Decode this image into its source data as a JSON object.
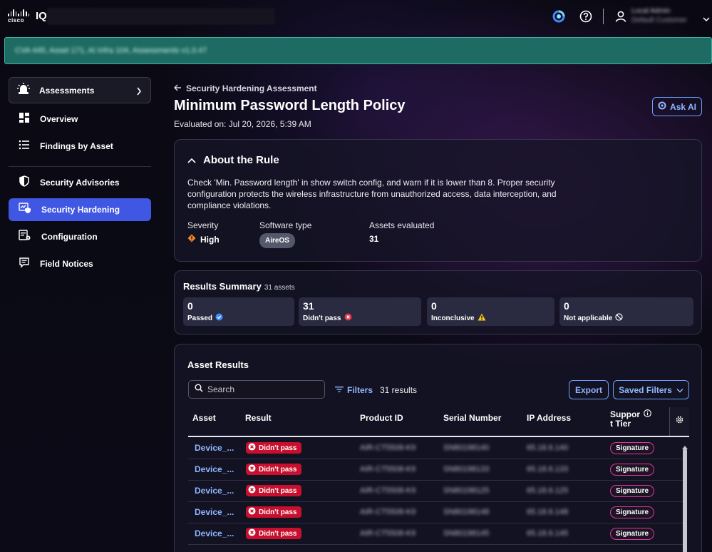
{
  "topbar": {
    "brand": "cisco",
    "product": "IQ",
    "user_name": "Local Admin",
    "user_org": "Default Customer"
  },
  "banner": {
    "text": "CVA 445, Asset 171, AI Infra 104, Assessments v1.0.47"
  },
  "sidebar": {
    "header": "Assessments",
    "items": [
      {
        "label": "Overview"
      },
      {
        "label": "Findings by Asset"
      },
      {
        "label": "Security Advisories"
      },
      {
        "label": "Security Hardening"
      },
      {
        "label": "Configuration"
      },
      {
        "label": "Field Notices"
      }
    ]
  },
  "page": {
    "back_label": "Security Hardening Assessment",
    "title": "Minimum Password Length Policy",
    "evaluated": "Evaluated on: Jul 20, 2026, 5:39 AM",
    "ask_ai": "Ask AI"
  },
  "about": {
    "heading": "About the Rule",
    "description": "Check 'Min. Password length' in show switch config, and warn if it is lower than 8. Proper security configuration protects the wireless infrastructure from unauthorized access, data interception, and compliance violations.",
    "severity_label": "Severity",
    "severity_value": "High",
    "software_label": "Software type",
    "software_value": "AireOS",
    "assets_label": "Assets evaluated",
    "assets_value": "31"
  },
  "summary": {
    "title": "Results Summary",
    "subtitle": "31 assets",
    "stats": [
      {
        "num": "0",
        "label": "Passed"
      },
      {
        "num": "31",
        "label": "Didn't pass"
      },
      {
        "num": "0",
        "label": "Inconclusive"
      },
      {
        "num": "0",
        "label": "Not applicable"
      }
    ]
  },
  "assets": {
    "title": "Asset Results",
    "search_placeholder": "Search",
    "filters_label": "Filters",
    "results_count": "31 results",
    "export_label": "Export",
    "saved_filters_label": "Saved Filters",
    "columns": [
      "Asset",
      "Result",
      "Product ID",
      "Serial Number",
      "IP Address",
      "Suppor",
      "t Tier"
    ],
    "rows": [
      {
        "asset": "Device_...",
        "result": "Didn't pass",
        "product": "AIR-CT5508-K9",
        "serial": "SN80198140",
        "ip": "65.18.6.140",
        "tier": "Signature"
      },
      {
        "asset": "Device_...",
        "result": "Didn't pass",
        "product": "AIR-CT5508-K9",
        "serial": "SN80198133",
        "ip": "65.18.6.133",
        "tier": "Signature"
      },
      {
        "asset": "Device_...",
        "result": "Didn't pass",
        "product": "AIR-CT5508-K9",
        "serial": "SN80198125",
        "ip": "65.18.6.125",
        "tier": "Signature"
      },
      {
        "asset": "Device_...",
        "result": "Didn't pass",
        "product": "AIR-CT5508-K9",
        "serial": "SN80198148",
        "ip": "65.18.6.148",
        "tier": "Signature"
      },
      {
        "asset": "Device_...",
        "result": "Didn't pass",
        "product": "AIR-CT5508-K9",
        "serial": "SN80198145",
        "ip": "65.18.6.145",
        "tier": "Signature"
      }
    ]
  },
  "colors": {
    "accent_blue": "#4057e3",
    "link_blue": "#8fb6ff",
    "fail_red": "#c8102e",
    "banner_teal": "#1d6b63",
    "tier_pink": "#e0369a",
    "severity_orange": "#f08a24"
  }
}
